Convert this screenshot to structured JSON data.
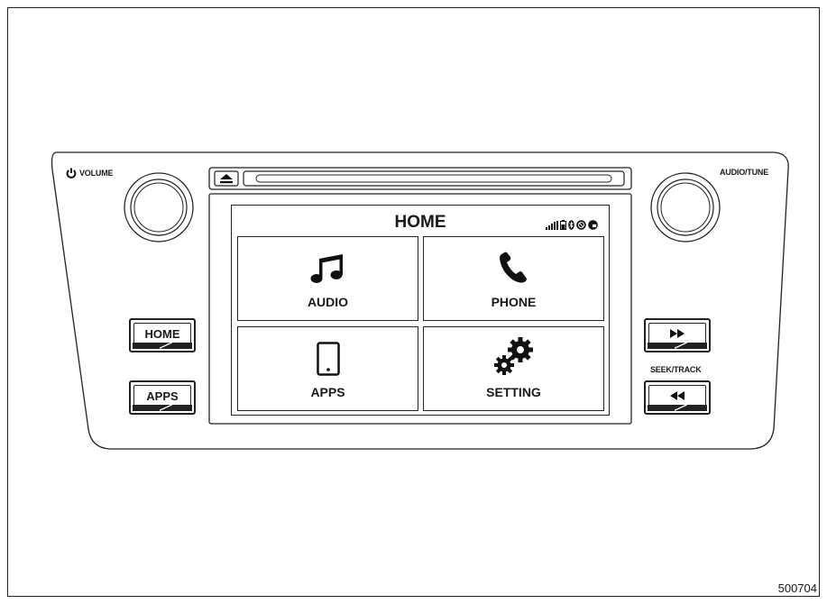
{
  "labels": {
    "volume": "VOLUME",
    "audio_tune": "AUDIO/TUNE",
    "seek_track": "SEEK/TRACK"
  },
  "buttons": {
    "home": "HOME",
    "apps": "APPS",
    "fast_forward_icon": "fast-forward-icon",
    "rewind_icon": "rewind-icon"
  },
  "screen": {
    "title": "HOME",
    "tiles": [
      {
        "label": "AUDIO",
        "icon": "music-note-icon"
      },
      {
        "label": "PHONE",
        "icon": "phone-handset-icon"
      },
      {
        "label": "APPS",
        "icon": "tablet-icon"
      },
      {
        "label": "SETTING",
        "icon": "gears-icon"
      }
    ],
    "status_icons": [
      "signal-bars-icon",
      "battery-icon",
      "bluetooth-icon",
      "no-connection-icon",
      "message-icon"
    ]
  },
  "figure_number": "500704"
}
